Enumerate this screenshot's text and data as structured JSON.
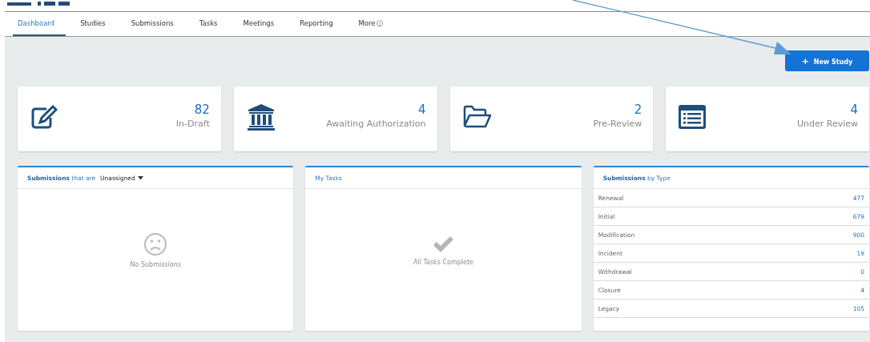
{
  "tabs": [
    {
      "label": "Dashboard",
      "selected": true
    },
    {
      "label": "Studies",
      "selected": false
    },
    {
      "label": "Submissions",
      "selected": false
    },
    {
      "label": "Tasks",
      "selected": false
    },
    {
      "label": "Meetings",
      "selected": false
    },
    {
      "label": "Reporting",
      "selected": false
    },
    {
      "label": "More",
      "selected": false,
      "info": "ⓘ"
    }
  ],
  "new_study_button": {
    "icon": "+",
    "label": "New Study"
  },
  "stat_cards": [
    {
      "kind": "draft",
      "value": "82",
      "label": "In-Draft"
    },
    {
      "kind": "authorization",
      "value": "4",
      "label": "Awaiting Authorization"
    },
    {
      "kind": "prereview",
      "value": "2",
      "label": "Pre-Review"
    },
    {
      "kind": "review",
      "value": "4",
      "label": "Under Review"
    }
  ],
  "submissions_panel": {
    "title": "**Submissions** that are",
    "filter": "Unassigned",
    "empty_text": "No Submissions"
  },
  "tasks_panel": {
    "title": "My Tasks",
    "empty_text": "All Tasks Complete"
  },
  "by_type_panel": {
    "title": "**Submissions** by Type",
    "rows": [
      {
        "type": "Renewal",
        "count": "477"
      },
      {
        "type": "Initial",
        "count": "679"
      },
      {
        "type": "Modification",
        "count": "900"
      },
      {
        "type": "Incident",
        "count": "19"
      },
      {
        "type": "Withdrawal",
        "count": "0"
      },
      {
        "type": "Closure",
        "count": "4"
      },
      {
        "type": "Legacy",
        "count": "105"
      }
    ]
  }
}
